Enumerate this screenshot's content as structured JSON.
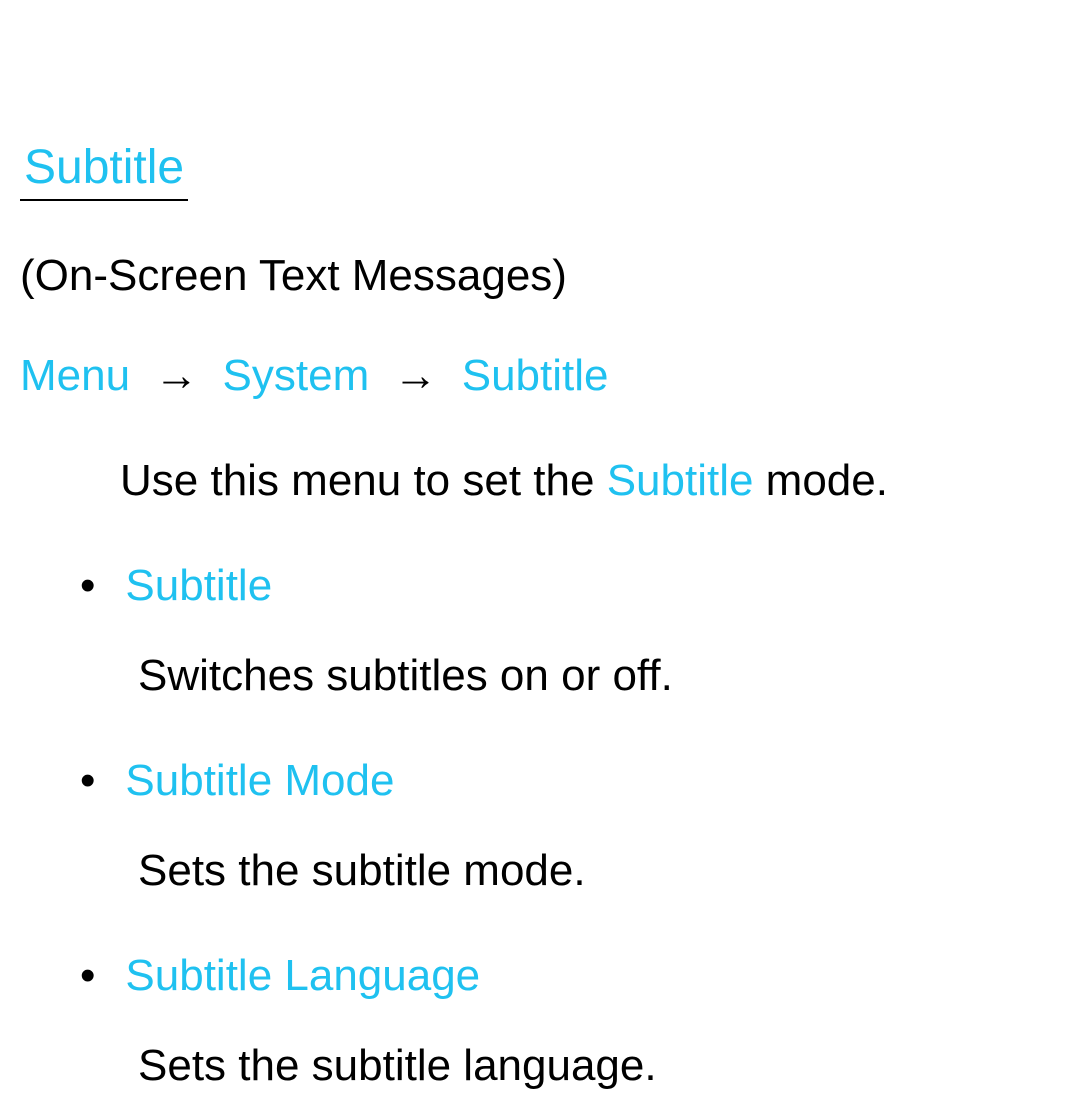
{
  "title": "Subtitle",
  "subhead": "(On-Screen Text Messages)",
  "breadcrumb": {
    "items": [
      "Menu",
      "System",
      "Subtitle"
    ],
    "arrow": "→"
  },
  "intro": {
    "prefix": "Use this menu to set the ",
    "highlight": "Subtitle",
    "suffix": " mode."
  },
  "items": [
    {
      "label": "Subtitle",
      "desc": "Switches subtitles on or off."
    },
    {
      "label": "Subtitle Mode",
      "desc": "Sets the subtitle mode."
    },
    {
      "label": "Subtitle Language",
      "desc": "Sets the subtitle language."
    }
  ]
}
